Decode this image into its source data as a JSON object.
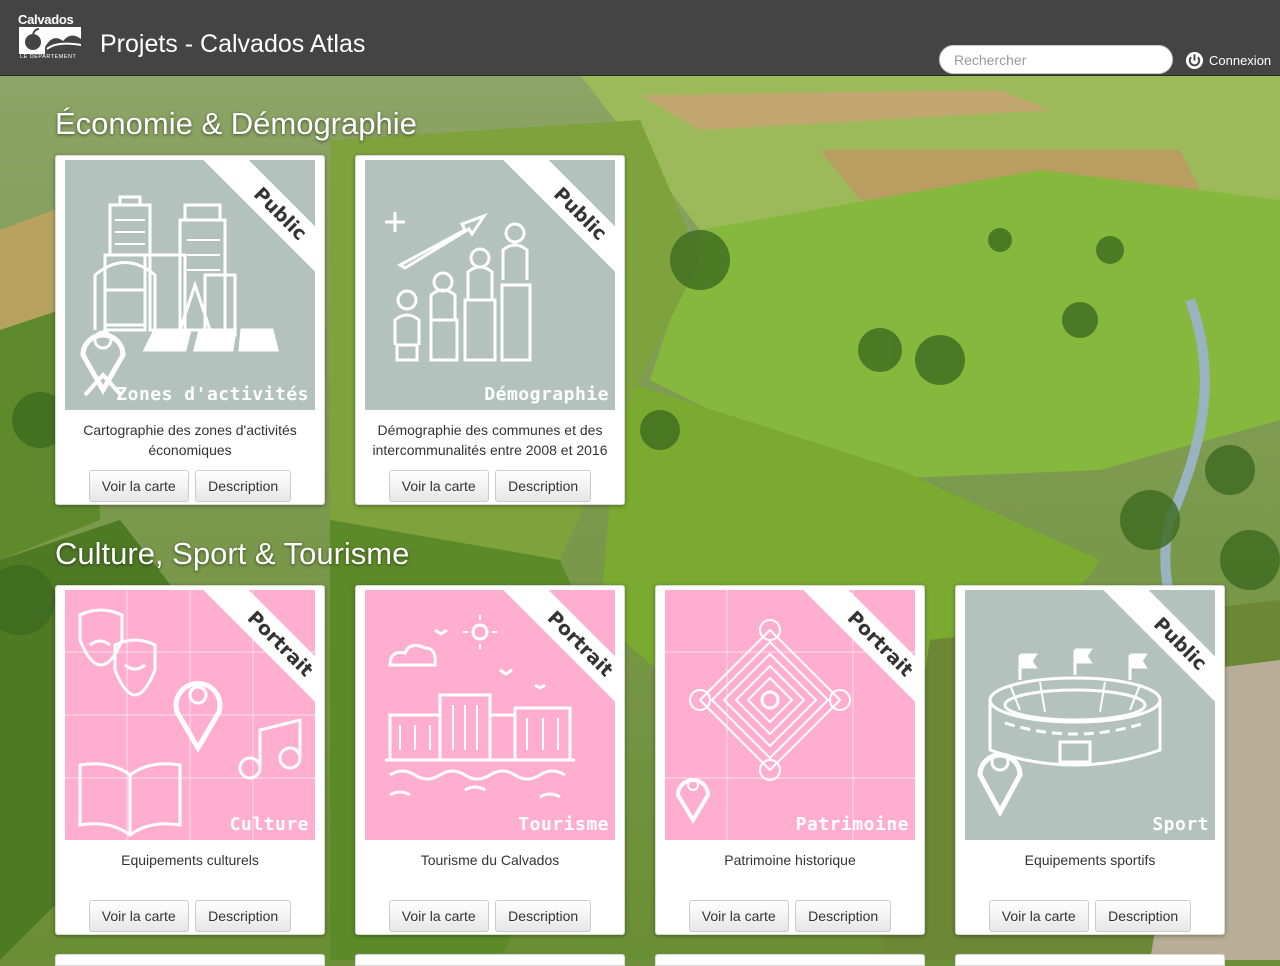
{
  "header": {
    "logo_brand": "Calvados",
    "logo_tagline": "LE DÉPARTEMENT",
    "title": "Projets - Calvados Atlas",
    "search_placeholder": "Rechercher",
    "login_label": "Connexion",
    "login_icon": "power-icon"
  },
  "sections": [
    {
      "title": "Économie & Démographie",
      "cards": [
        {
          "badge": "Public",
          "theme": "Zones d'activités",
          "description": "Cartographie des zones d'activités économiques",
          "icon": "city-buildings-icon",
          "color": "#b3c2bc"
        },
        {
          "badge": "Public",
          "theme": "Démographie",
          "description": "Démographie des communes et des intercommunalités entre 2008 et 2016",
          "icon": "population-growth-icon",
          "color": "#b3c2bc"
        }
      ]
    },
    {
      "title": "Culture, Sport & Tourisme",
      "cards": [
        {
          "badge": "Portrait",
          "theme": "Culture",
          "description": "Equipements culturels",
          "icon": "culture-theatre-icon",
          "color": "#ffaed0"
        },
        {
          "badge": "Portrait",
          "theme": "Tourisme",
          "description": "Tourisme du Calvados",
          "icon": "seaside-town-icon",
          "color": "#ffaed0"
        },
        {
          "badge": "Portrait",
          "theme": "Patrimoine",
          "description": "Patrimoine historique",
          "icon": "labyrinth-icon",
          "color": "#ffaed0"
        },
        {
          "badge": "Public",
          "theme": "Sport",
          "description": "Equipements sportifs",
          "icon": "stadium-icon",
          "color": "#b3c2bc"
        }
      ]
    }
  ],
  "buttons": {
    "map": "Voir la carte",
    "description": "Description"
  }
}
